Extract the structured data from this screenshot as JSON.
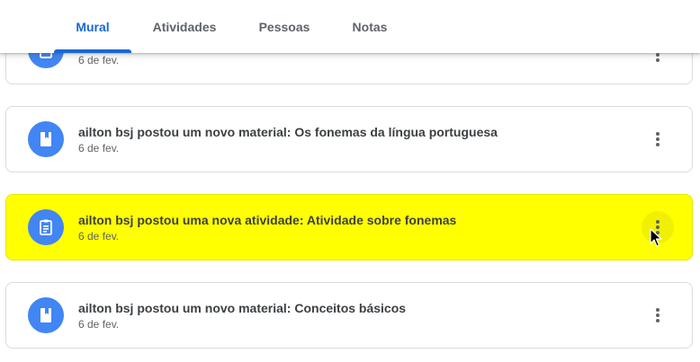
{
  "tabs": [
    {
      "label": "Mural",
      "active": true
    },
    {
      "label": "Atividades",
      "active": false
    },
    {
      "label": "Pessoas",
      "active": false
    },
    {
      "label": "Notas",
      "active": false
    }
  ],
  "posts": [
    {
      "title": "",
      "date": "6 de fev.",
      "icon": "book-icon",
      "highlighted": false
    },
    {
      "title": "ailton bsj postou um novo material: Os fonemas da língua portuguesa",
      "date": "6 de fev.",
      "icon": "book-icon",
      "highlighted": false
    },
    {
      "title": "ailton bsj postou uma nova atividade: Atividade sobre fonemas",
      "date": "6 de fev.",
      "icon": "assignment-icon",
      "highlighted": true
    },
    {
      "title": "ailton bsj postou um novo material: Conceitos básicos",
      "date": "6 de fev.",
      "icon": "book-icon",
      "highlighted": false
    }
  ],
  "colors": {
    "accent": "#1967d2",
    "avatar": "#4285f4",
    "highlight": "#ffff00",
    "text": "#3c4043",
    "subtext": "#5f6368"
  }
}
